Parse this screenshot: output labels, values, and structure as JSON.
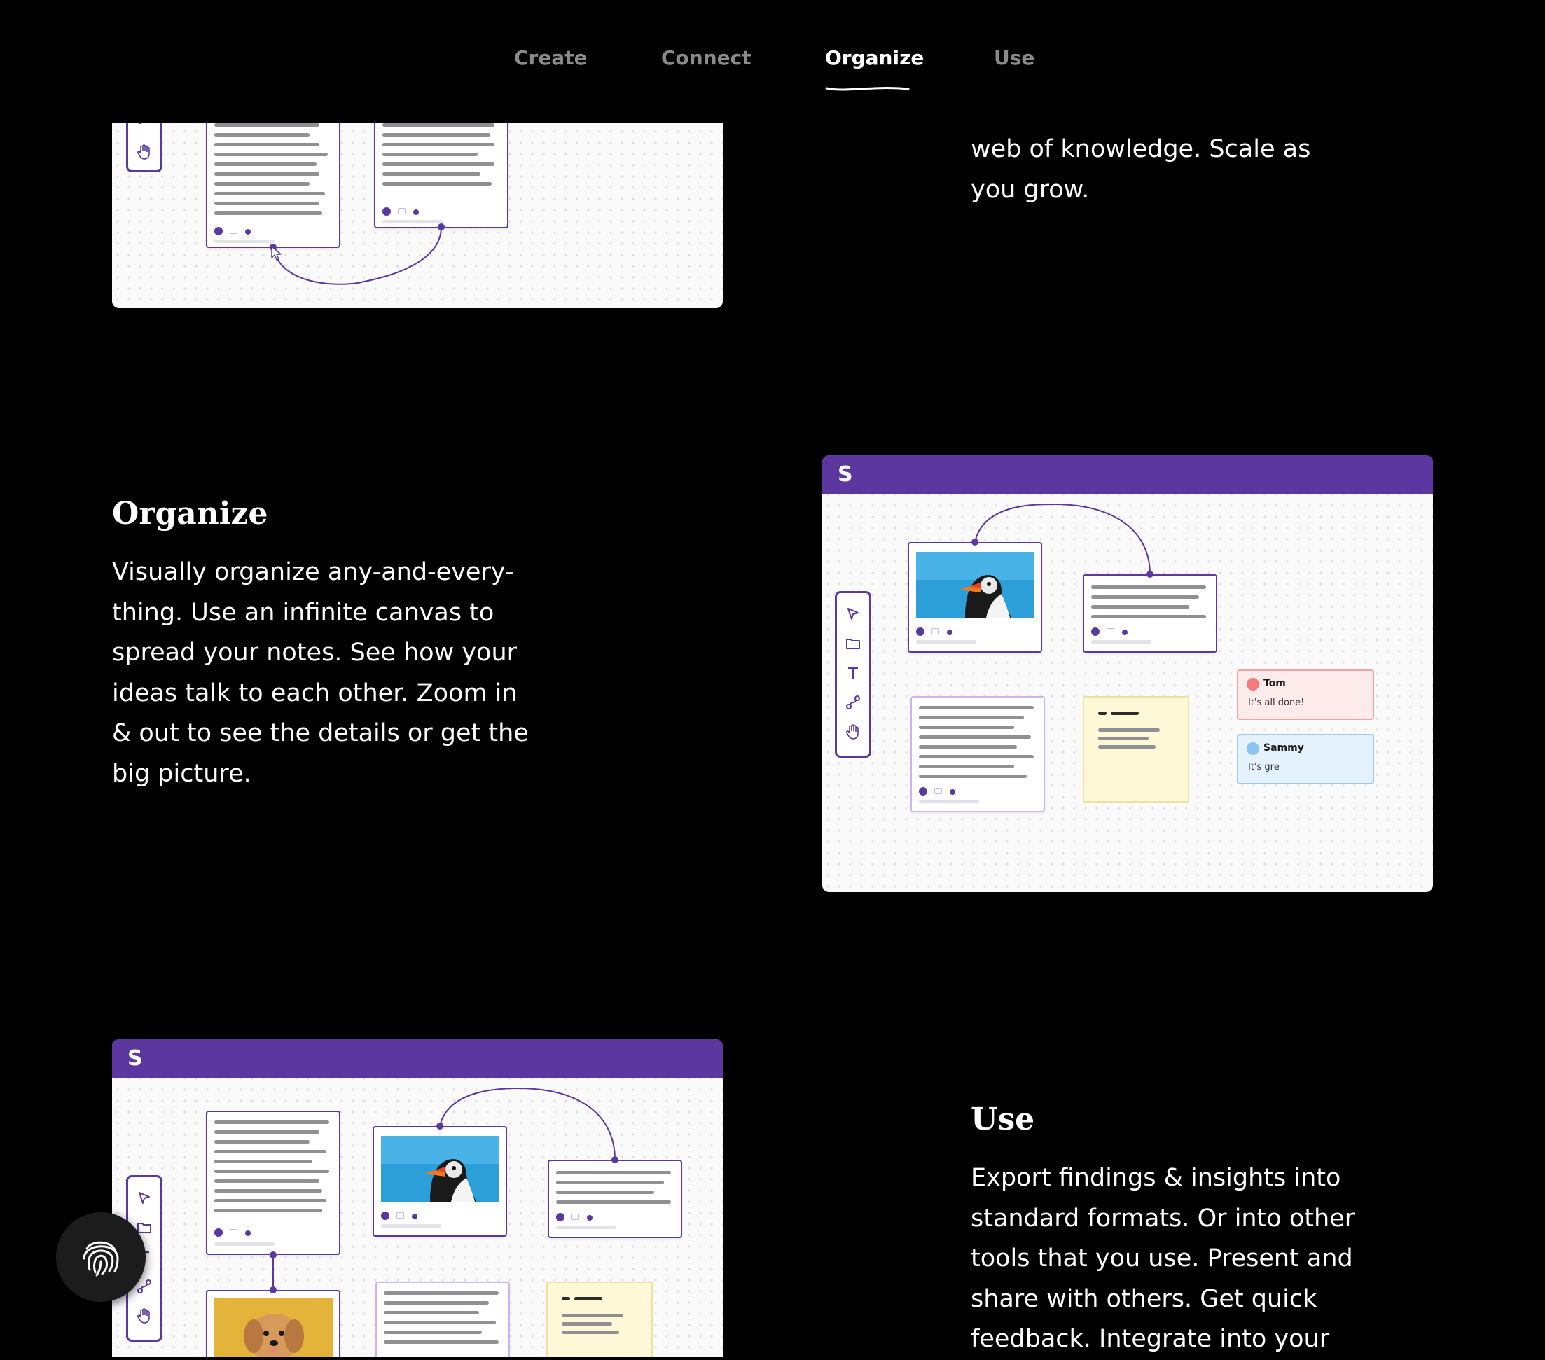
{
  "nav": {
    "tabs": [
      {
        "label": "Create"
      },
      {
        "label": "Connect"
      },
      {
        "label": "Organize"
      },
      {
        "label": "Use"
      }
    ],
    "active_index": 2
  },
  "connect_section": {
    "body_tail": "web of knowledge. Scale as you grow."
  },
  "organize_section": {
    "title": "Organize",
    "body": "Visually organize any-and-every-thing. Use an infinite canvas to spread your notes. See how your ideas talk to each other. Zoom in & out to see the details or get the big picture."
  },
  "use_section": {
    "title": "Use",
    "body": "Export findings & insights into standard formats. Or into other tools that you use. Present and share with others. Get quick feedback. Integrate into your"
  },
  "mock": {
    "logo": "S",
    "comments": [
      {
        "name": "Tom",
        "message": "It's all done!",
        "color": "#f47b7b"
      },
      {
        "name": "Sammy",
        "message": "It's gre",
        "color": "#8cc3f2"
      }
    ]
  },
  "colors": {
    "brand": "#5b379f",
    "background": "#000000",
    "nav_inactive": "#8a8a8a",
    "sticky": "#fff8d6",
    "comment_red_bg": "#fdeaea",
    "comment_blue_bg": "#e4f2fd"
  },
  "icons": [
    "pointer-icon",
    "folder-icon",
    "text-icon",
    "connector-icon",
    "hand-icon",
    "fingerprint-icon"
  ]
}
